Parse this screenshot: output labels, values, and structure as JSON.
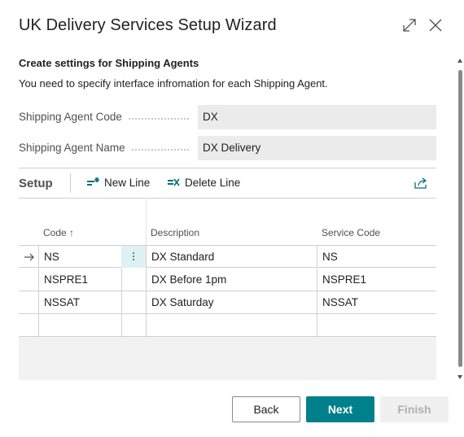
{
  "dialog": {
    "title": "UK Delivery Services Setup Wizard",
    "icons": {
      "expand": "expand-icon",
      "close": "close-icon"
    }
  },
  "step": {
    "heading": "Create settings for Shipping Agents",
    "instructions": "You need to specify interface infromation for each Shipping Agent."
  },
  "fields": {
    "agent_code": {
      "label": "Shipping Agent Code",
      "value": "DX"
    },
    "agent_name": {
      "label": "Shipping Agent Name",
      "value": "DX Delivery"
    }
  },
  "setup": {
    "title": "Setup",
    "actions": {
      "new_line": "New Line",
      "delete_line": "Delete Line"
    },
    "share_icon": "share-icon",
    "columns": {
      "code": "Code ↑",
      "description": "Description",
      "service_code": "Service Code"
    },
    "rows": [
      {
        "code": "NS",
        "description": "DX Standard",
        "service_code": "NS"
      },
      {
        "code": "NSPRE1",
        "description": "DX Before 1pm",
        "service_code": "NSPRE1"
      },
      {
        "code": "NSSAT",
        "description": "DX Saturday",
        "service_code": "NSSAT"
      },
      {
        "code": "",
        "description": "",
        "service_code": ""
      }
    ]
  },
  "footer": {
    "back": "Back",
    "next": "Next",
    "finish": "Finish"
  },
  "colors": {
    "accent": "#00808b",
    "selected_cell": "#dff1f3",
    "field_bg": "#ebebeb"
  }
}
